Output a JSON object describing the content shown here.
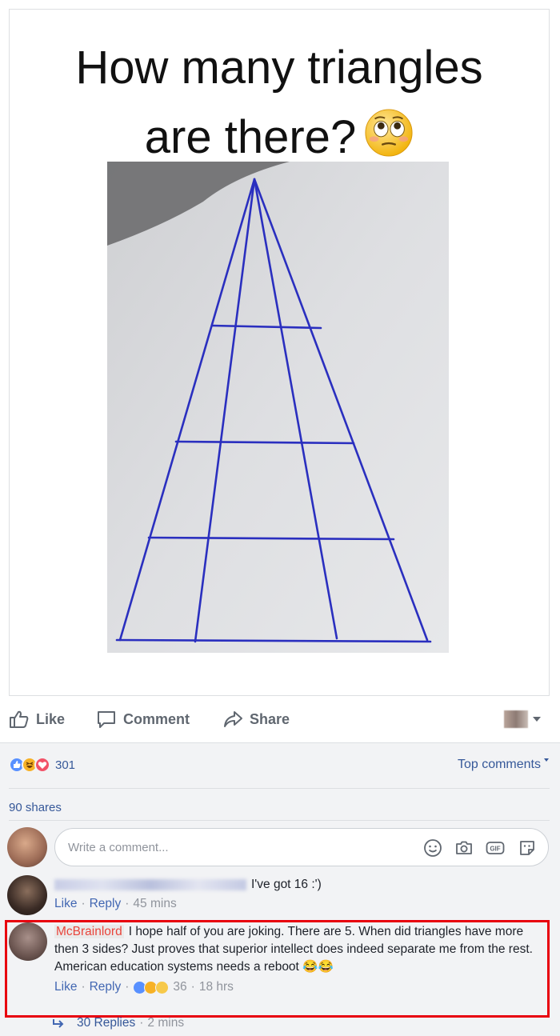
{
  "post": {
    "title_line1": "How many triangles",
    "title_line2": "are there?"
  },
  "actions": {
    "like": "Like",
    "comment": "Comment",
    "share": "Share"
  },
  "reactions": {
    "count": "301",
    "sort_label": "Top comments"
  },
  "shares": "90 shares",
  "composer": {
    "placeholder": "Write a comment..."
  },
  "comments": [
    {
      "author": "",
      "text": "I've got 16 :')",
      "like": "Like",
      "reply": "Reply",
      "time": "45 mins"
    },
    {
      "author": "McBrainlord",
      "text": "I hope half of you are joking. There are 5. When did triangles have more then 3 sides? Just proves that superior intellect does indeed separate me from the rest. American education systems needs a reboot 😂😂",
      "like": "Like",
      "reply": "Reply",
      "reaction_count": "36",
      "time": "18 hrs"
    }
  ],
  "replies": {
    "label": "30 Replies",
    "time": "2 mins"
  },
  "colors": {
    "link": "#365899",
    "highlight": "#e8000e",
    "ink": "#2a2fbf"
  }
}
